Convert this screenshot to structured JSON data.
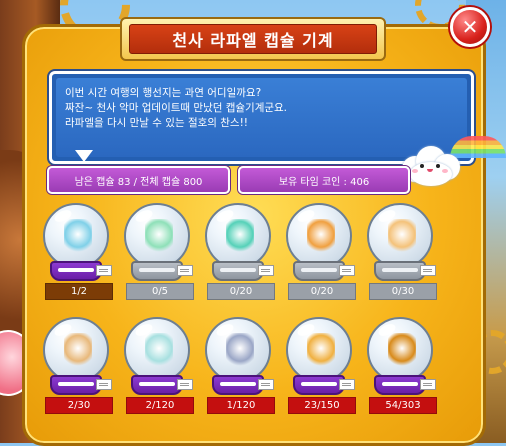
{
  "window": {
    "title": "천사 라파엘 캡슐 기계",
    "close_glyph": "✕"
  },
  "description": {
    "lines": [
      "이번 시간 여행의 행선지는 과연 어디일까요?",
      "짜잔~ 천사 악마 업데이트때 만났던 캡슐기계군요.",
      "라파엘을 다시 만날 수 있는 절호의 찬스!!"
    ]
  },
  "info": {
    "capsule_status": "남은 캡슐 83 / 전체 캡슐 800",
    "coin_status": "보유 타임 코인 : 406"
  },
  "capsules_row1": [
    {
      "count": "1/2",
      "icon": "angel-wings-icon",
      "art_color": "#7fd0e8",
      "state": "available"
    },
    {
      "count": "0/5",
      "icon": "winged-pet-icon",
      "art_color": "#8ee0b8",
      "state": "empty"
    },
    {
      "count": "0/20",
      "icon": "green-hair-icon",
      "art_color": "#55d1b8",
      "state": "empty"
    },
    {
      "count": "0/20",
      "icon": "orange-wings-icon",
      "art_color": "#f0a040",
      "state": "empty"
    },
    {
      "count": "0/30",
      "icon": "angel-gloves-icon",
      "art_color": "#f4c27a",
      "state": "empty"
    }
  ],
  "capsules_row2": [
    {
      "count": "2/30",
      "icon": "armor-boots-icon",
      "art_color": "#e8b87a",
      "state": "low"
    },
    {
      "count": "2/120",
      "icon": "robe-outfit-icon",
      "art_color": "#a7e0e0",
      "state": "low"
    },
    {
      "count": "1/120",
      "icon": "staff-weapon-icon",
      "art_color": "#9aa6c6",
      "state": "low"
    },
    {
      "count": "23/150",
      "icon": "golden-figure-icon",
      "art_color": "#f0b040",
      "state": "low"
    },
    {
      "count": "54/303",
      "icon": "time-coin-icon",
      "art_color": "#d88a1a",
      "state": "low"
    }
  ]
}
